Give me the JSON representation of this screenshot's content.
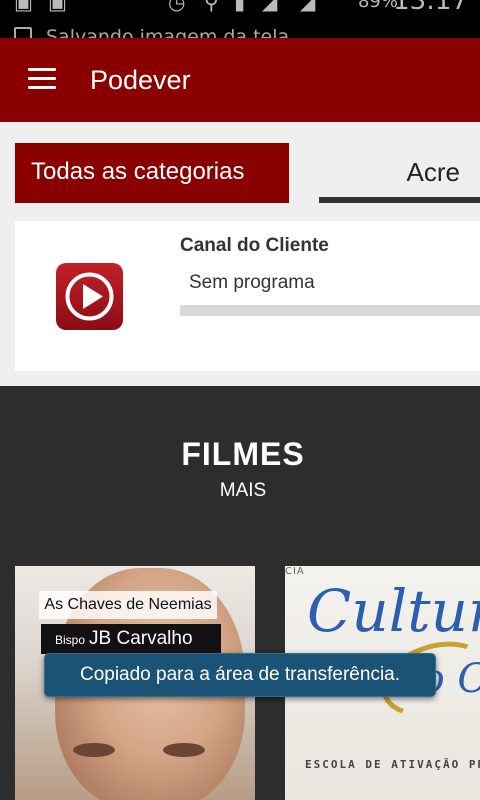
{
  "status_bar": {
    "battery": "89%",
    "time": "13:17",
    "notice": "Salvando imagem da tela..."
  },
  "app_bar": {
    "title": "Podever"
  },
  "filters": {
    "category_label": "Todas as categorias",
    "region_label": "Acre"
  },
  "channel": {
    "name": "Canal do Cliente",
    "program": "Sem programa",
    "progress": 0
  },
  "section": {
    "title": "FILMES",
    "more_label": "MAIS"
  },
  "posters": [
    {
      "title": "As Chaves de Neemias",
      "author_prefix": "Bispo",
      "author": "JB Carvalho"
    },
    {
      "top_text": "CIA",
      "title_line1": "Cultura",
      "title_line2": "do Céu",
      "subtitle": "ESCOLA DE ATIVAÇÃO PROFÉ"
    }
  ],
  "toast": {
    "message": "Copiado para a área de transferência."
  },
  "colors": {
    "primary": "#8a0000",
    "background": "#2d2d2d",
    "toast": "#1a5376"
  }
}
